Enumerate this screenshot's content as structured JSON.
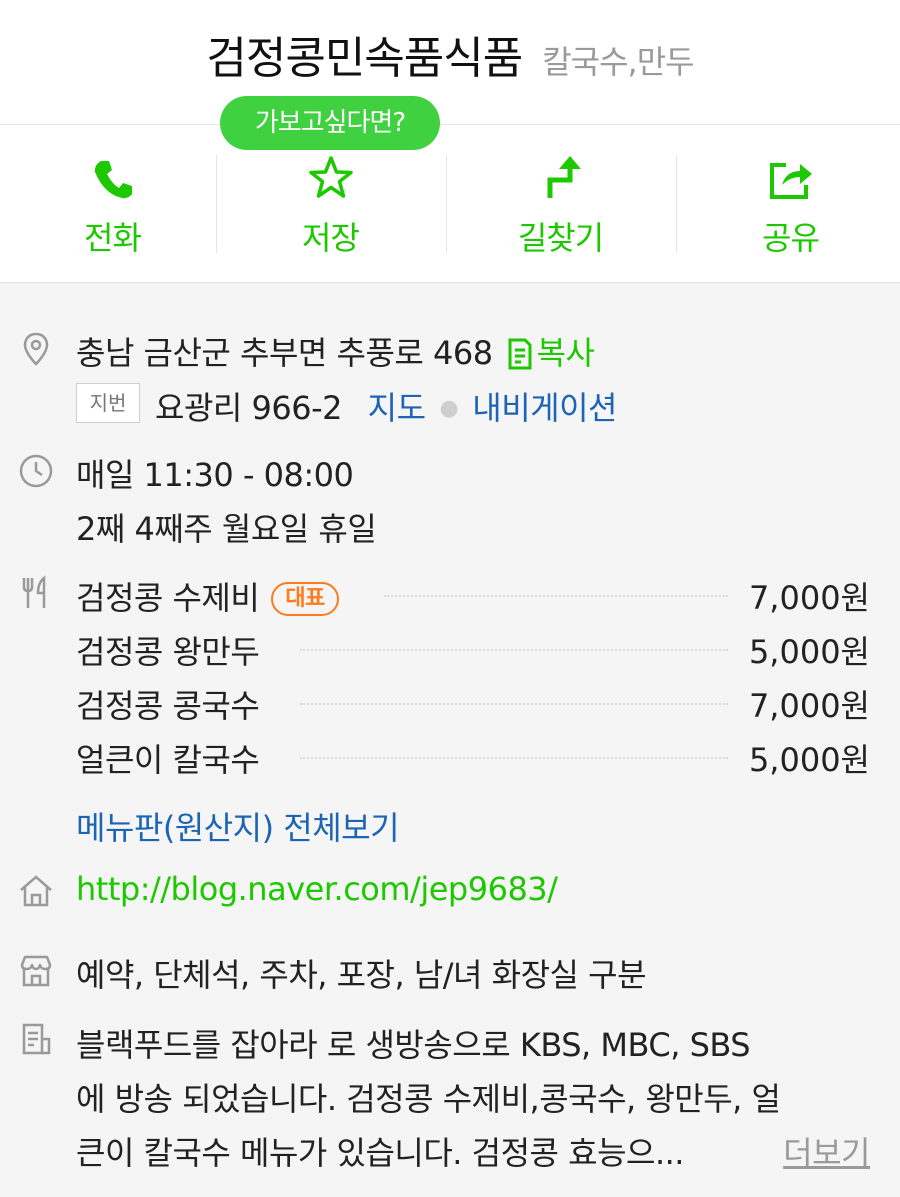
{
  "header": {
    "title": "검정콩민속품식품",
    "category": "칼국수,만두"
  },
  "tooltip": "가보고싶다면?",
  "actions": [
    {
      "label": "전화",
      "icon": "phone-icon"
    },
    {
      "label": "저장",
      "icon": "star-icon"
    },
    {
      "label": "길찾기",
      "icon": "directions-icon"
    },
    {
      "label": "공유",
      "icon": "share-icon"
    }
  ],
  "address": {
    "road": "충남 금산군 추부면 추풍로 468",
    "copy_label": "복사",
    "jibun_badge": "지번",
    "jibun": "요광리 966-2",
    "map_link": "지도",
    "nav_link": "내비게이션"
  },
  "hours": {
    "line1": "매일 11:30 - 08:00",
    "line2": "2째 4째주 월요일 휴일"
  },
  "menu": {
    "items": [
      {
        "name": "검정콩 수제비",
        "price": "7,000원",
        "badge": "대표"
      },
      {
        "name": "검정콩 왕만두",
        "price": "5,000원"
      },
      {
        "name": "검정콩 콩국수",
        "price": "7,000원"
      },
      {
        "name": "얼큰이 칼국수",
        "price": "5,000원"
      }
    ],
    "full_link": "메뉴판(원산지) 전체보기"
  },
  "homepage": "http://blog.naver.com/jep9683/",
  "facilities": "예약, 단체석, 주차, 포장, 남/녀 화장실 구분",
  "description": {
    "line1": "블랙푸드를 잡아라 로 생방송으로 KBS, MBC, SBS",
    "line2": "에 방송 되었습니다. 검정콩 수제비,콩국수, 왕만두, 얼",
    "line3": "큰이 칼국수 메뉴가 있습니다. 검정콩 효능으...",
    "more_label": "더보기"
  },
  "colors": {
    "accent_green": "#1ec800",
    "link_blue": "#1e64b4",
    "badge_orange": "#ff7a1a"
  }
}
